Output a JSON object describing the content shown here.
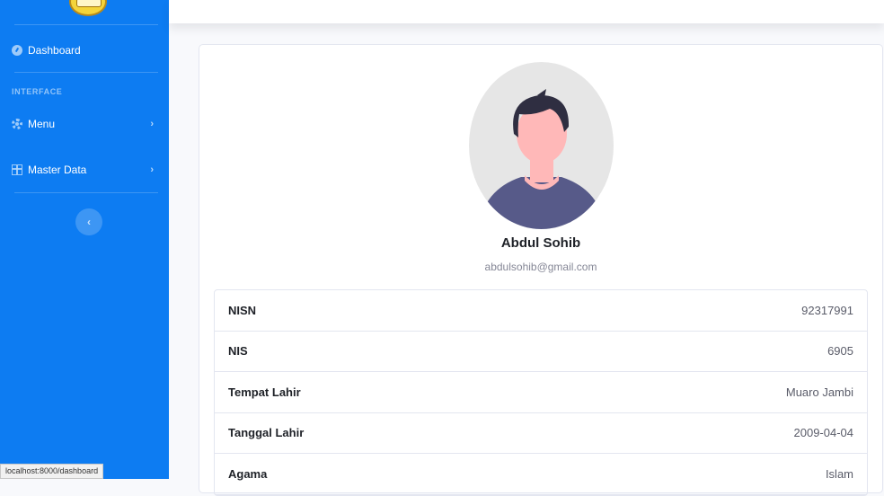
{
  "sidebar": {
    "items": [
      {
        "label": "Dashboard",
        "icon": "dashboard-icon"
      },
      {
        "label": "Menu",
        "icon": "gear-icon"
      },
      {
        "label": "Master Data",
        "icon": "table-icon"
      }
    ],
    "heading": "INTERFACE",
    "toggle_icon": "chevron-left-icon",
    "accent_color": "#0d7cf2"
  },
  "status_bar": {
    "url": "localhost:8000/dashboard"
  },
  "profile": {
    "name": "Abdul Sohib",
    "email": "abdulsohib@gmail.com",
    "avatar_icon": "user-avatar-illustration",
    "fields": [
      {
        "label": "NISN",
        "value": "92317991"
      },
      {
        "label": "NIS",
        "value": "6905"
      },
      {
        "label": "Tempat Lahir",
        "value": "Muaro Jambi"
      },
      {
        "label": "Tanggal Lahir",
        "value": "2009-04-04"
      },
      {
        "label": "Agama",
        "value": "Islam"
      }
    ]
  }
}
